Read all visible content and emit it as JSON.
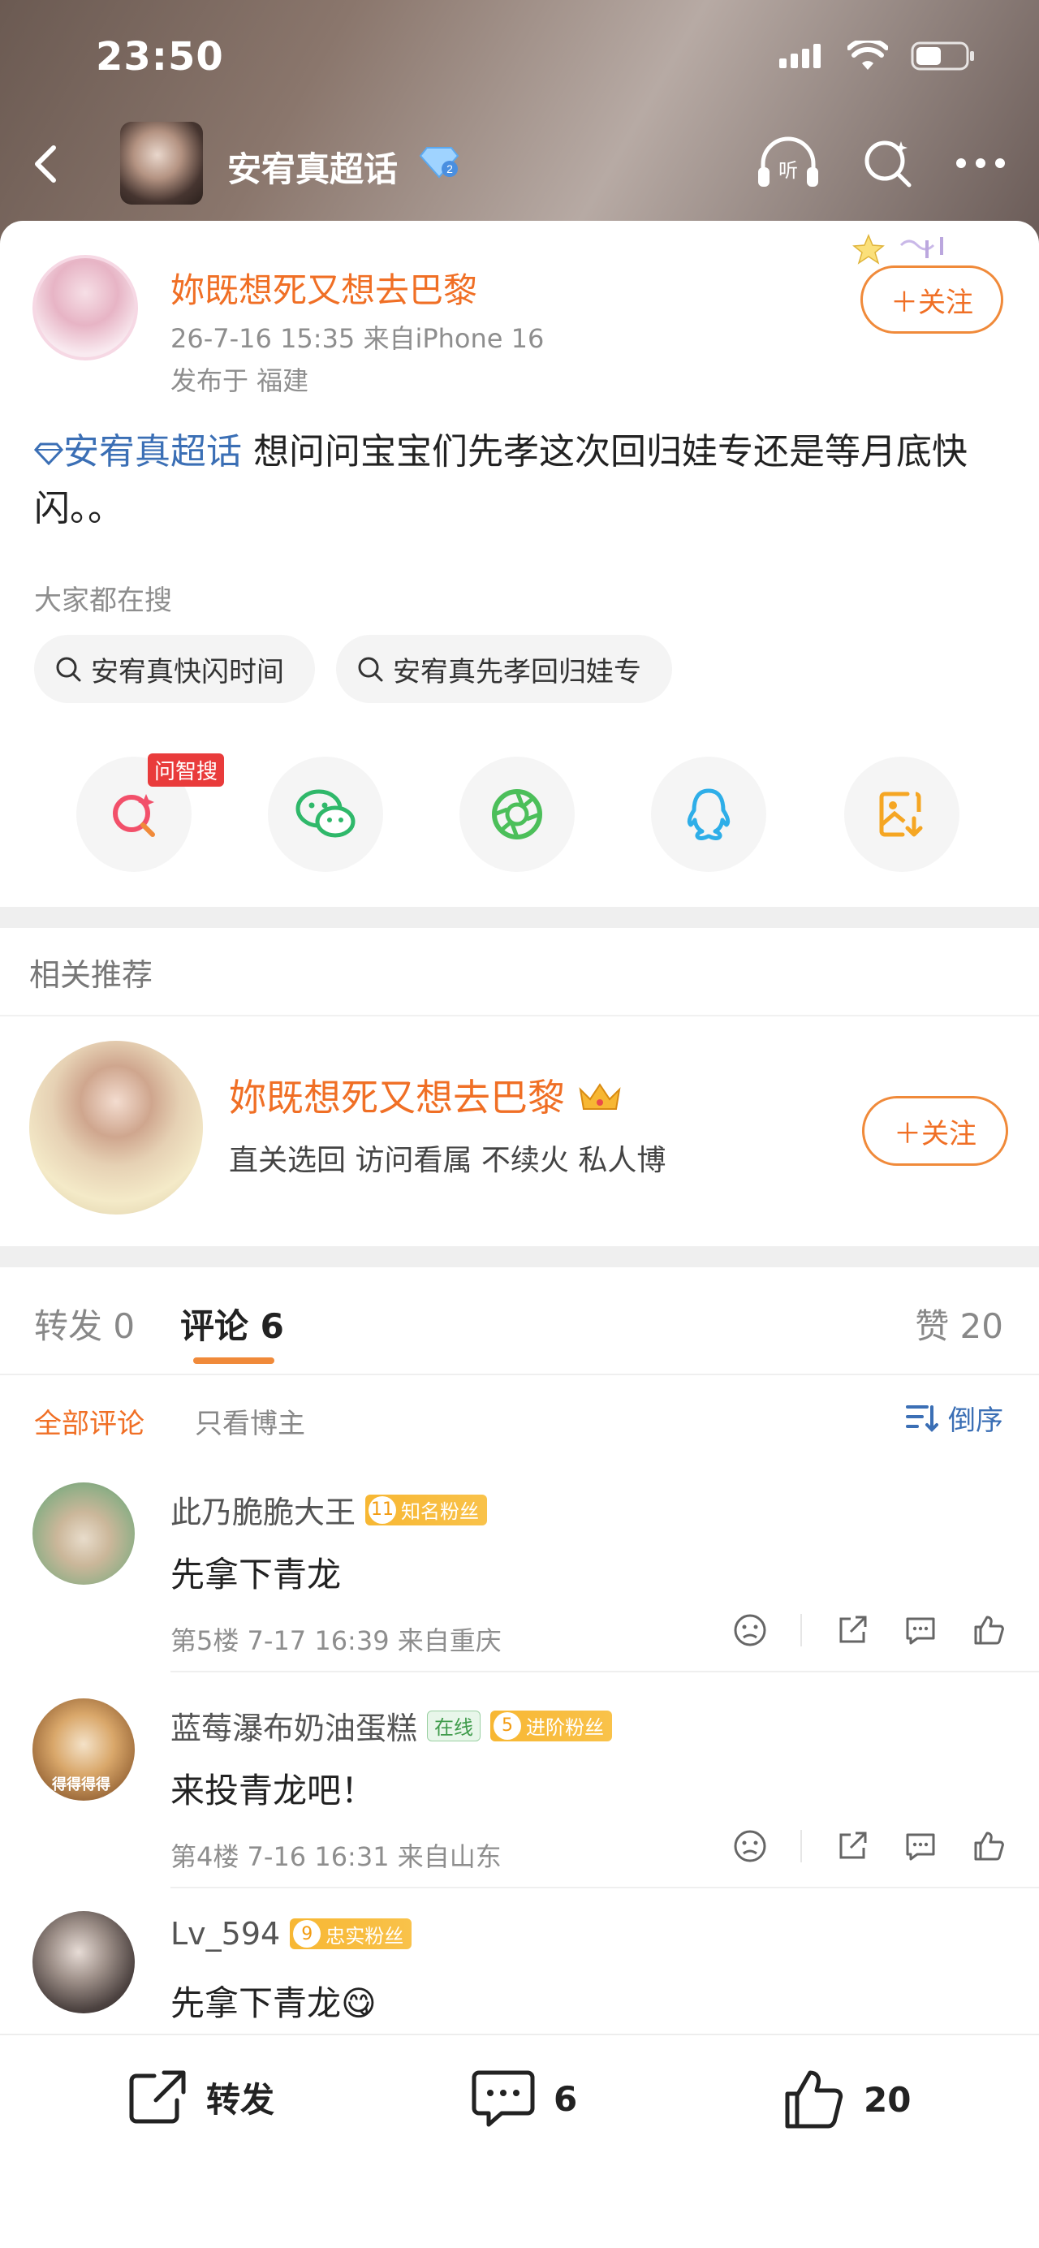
{
  "status": {
    "time": "23:50"
  },
  "header": {
    "title": "安宥真超话"
  },
  "post": {
    "author": "妳既想死又想去巴黎",
    "meta": "26-7-16 15:35  来自iPhone 16",
    "location": "发布于 福建",
    "follow_label": "＋关注",
    "topic": "安宥真超话",
    "body": " 想问问宝宝们先孝这次回归娃专还是等月底快闪。。",
    "search_hint": "大家都在搜",
    "search_chips": [
      "安宥真快闪时间",
      "安宥真先孝回归娃专"
    ],
    "share_badge": "问智搜"
  },
  "related": {
    "title": "相关推荐",
    "name": "妳既想死又想去巴黎",
    "desc": "直关选回 访问看属 不续火 私人博",
    "follow_label": "＋关注"
  },
  "tabs": {
    "repost": "转发 0",
    "comments": "评论 6",
    "likes": "赞 20"
  },
  "filters": {
    "all": "全部评论",
    "owner": "只看博主",
    "sort": "倒序"
  },
  "comments": [
    {
      "name": "此乃脆脆大王",
      "fan_level": "11",
      "fan_label": "知名粉丝",
      "text": "先拿下青龙",
      "meta": "第5楼 7-17 16:39 来自重庆"
    },
    {
      "name": "蓝莓瀑布奶油蛋糕",
      "online": "在线",
      "fan_level": "5",
      "fan_label": "进阶粉丝",
      "text": "来投青龙吧！",
      "meta": "第4楼 7-16 16:31 来自山东",
      "avatar_text": "得得得得"
    },
    {
      "name": "Lv_594",
      "fan_level": "9",
      "fan_label": "忠实粉丝",
      "text": "先拿下青龙",
      "emoji": "😋"
    }
  ],
  "bottom": {
    "repost": "转发",
    "comments": "6",
    "likes": "20"
  },
  "colors": {
    "accent": "#f06f25",
    "link": "#3b6fb5",
    "badge": "#f7b733"
  }
}
